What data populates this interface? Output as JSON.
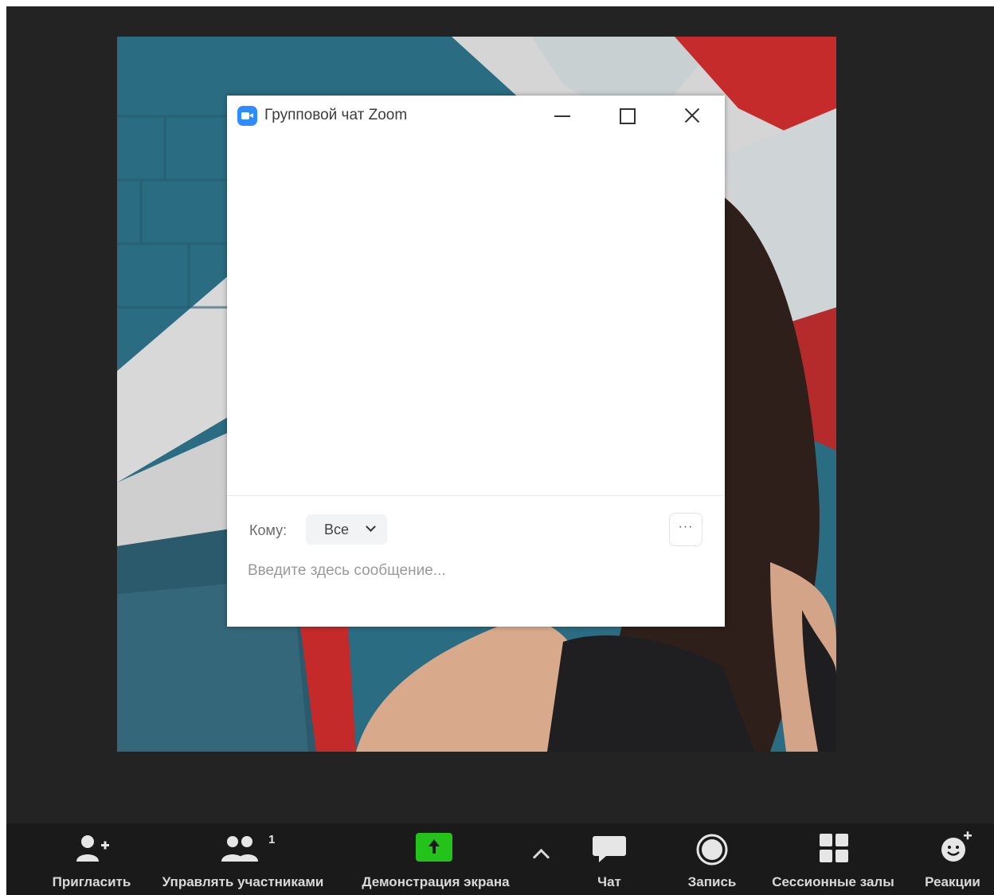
{
  "chat_window": {
    "title": "Групповой чат Zoom",
    "to_label": "Кому:",
    "recipient": "Все",
    "more_label": "···",
    "message_placeholder": "Введите здесь сообщение..."
  },
  "toolbar": {
    "invite": "Пригласить",
    "participants": "Управлять участниками",
    "participants_count": "1",
    "share_screen": "Демонстрация экрана",
    "chat": "Чат",
    "record": "Запись",
    "breakout_rooms": "Сессионные залы",
    "reactions": "Реакции"
  },
  "colors": {
    "share_green": "#23c31a",
    "zoom_blue": "#2d8cff",
    "toolbar_bg": "#1a1a1a"
  }
}
